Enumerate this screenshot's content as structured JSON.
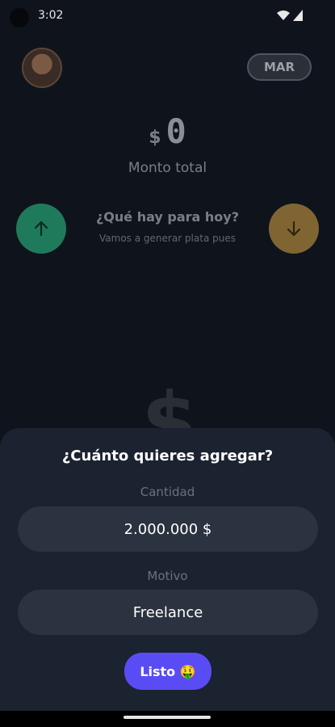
{
  "status": {
    "time": "3:02"
  },
  "header": {
    "month": "MAR"
  },
  "summary": {
    "currency": "$",
    "amount": "0",
    "label": "Monto total"
  },
  "prompt": {
    "title": "¿Qué hay para hoy?",
    "subtitle": "Vamos a generar plata pues"
  },
  "sheet": {
    "title": "¿Cuánto quieres agregar?",
    "amount_label": "Cantidad",
    "amount_value": "2.000.000 $",
    "reason_label": "Motivo",
    "reason_value": "Freelance",
    "done_label": "Listo 🤑"
  },
  "icons": {
    "income": "arrow-up-icon",
    "expense": "arrow-down-icon",
    "wifi": "wifi-icon",
    "signal": "signal-icon"
  },
  "colors": {
    "accent": "#5a4cf5",
    "income": "#1f7a5b",
    "expense": "#806533",
    "sheet": "#1b2230"
  }
}
